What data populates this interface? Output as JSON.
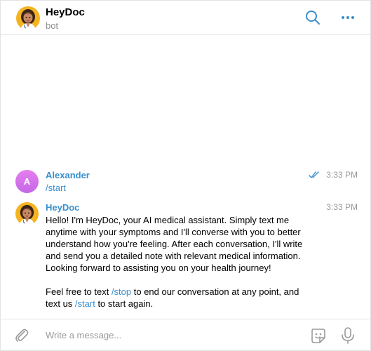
{
  "header": {
    "title": "HeyDoc",
    "status": "bot",
    "search_icon": "search-icon",
    "more_icon": "more-dots-icon"
  },
  "messages": [
    {
      "sender": "Alexander",
      "avatar_letter": "A",
      "time": "3:33 PM",
      "read": true,
      "text": "/start"
    },
    {
      "sender": "HeyDoc",
      "time": "3:33 PM",
      "paragraph1": "Hello! I'm HeyDoc, your AI medical assistant. Simply text me anytime with your symptoms and I'll converse with you to better understand how you're feeling. After each conversation, I'll write and send you a detailed note with relevant medical information. Looking forward to assisting you on your health journey!",
      "p2_before_stop": "Feel free to text ",
      "p2_stop_cmd": "/stop",
      "p2_after_stop": " to end our conversation at any point, and text us ",
      "p2_start_cmd": "/start",
      "p2_end": " to start again."
    }
  ],
  "composer": {
    "placeholder": "Write a message...",
    "value": "",
    "attach_icon": "paperclip-icon",
    "sticker_icon": "sticker-icon",
    "mic_icon": "microphone-icon"
  },
  "colors": {
    "accent": "#3a8fcd",
    "avatar_gradient": "#d876ee"
  }
}
